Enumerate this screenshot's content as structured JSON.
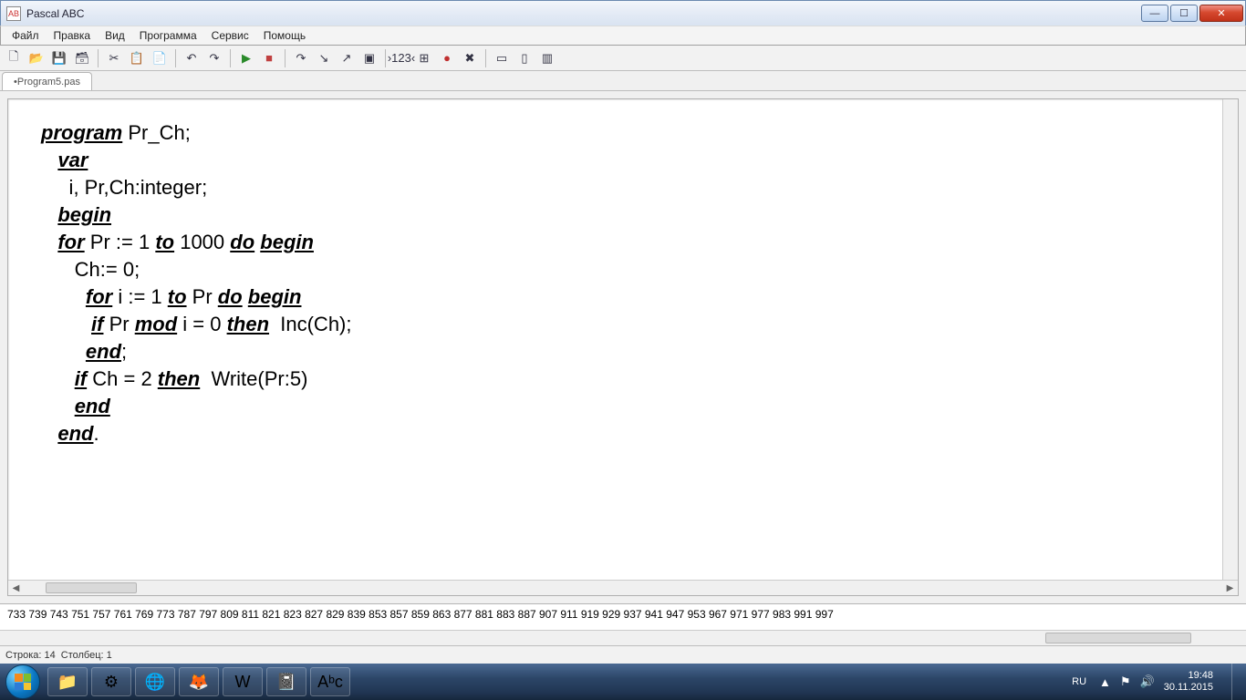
{
  "window": {
    "app_icon_text": "AB",
    "title": "Pascal ABC"
  },
  "menubar": [
    "Файл",
    "Правка",
    "Вид",
    "Программа",
    "Сервис",
    "Помощь"
  ],
  "toolbar_icons": [
    {
      "name": "new-file-icon",
      "glyph": "🗋"
    },
    {
      "name": "open-file-icon",
      "glyph": "📂"
    },
    {
      "name": "save-icon",
      "glyph": "💾"
    },
    {
      "name": "save-all-icon",
      "glyph": "🗃"
    },
    {
      "sep": true
    },
    {
      "name": "cut-icon",
      "glyph": "✂"
    },
    {
      "name": "copy-icon",
      "glyph": "📋"
    },
    {
      "name": "paste-icon",
      "glyph": "📄"
    },
    {
      "sep": true
    },
    {
      "name": "undo-icon",
      "glyph": "↶"
    },
    {
      "name": "redo-icon",
      "glyph": "↷"
    },
    {
      "sep": true
    },
    {
      "name": "run-icon",
      "glyph": "▶",
      "cls": "ico-play"
    },
    {
      "name": "stop-icon",
      "glyph": "■",
      "cls": "ico-stop"
    },
    {
      "sep": true
    },
    {
      "name": "step-over-icon",
      "glyph": "↷"
    },
    {
      "name": "step-into-icon",
      "glyph": "↘"
    },
    {
      "name": "step-out-icon",
      "glyph": "↗"
    },
    {
      "name": "run-to-cursor-icon",
      "glyph": "▣"
    },
    {
      "sep": true
    },
    {
      "name": "watch-icon",
      "glyph": "›123‹"
    },
    {
      "name": "locals-icon",
      "glyph": "⊞"
    },
    {
      "name": "breakpoint-icon",
      "glyph": "●",
      "cls": "ico-red"
    },
    {
      "name": "clear-icon",
      "glyph": "✖"
    },
    {
      "sep": true
    },
    {
      "name": "panel1-icon",
      "glyph": "▭"
    },
    {
      "name": "panel2-icon",
      "glyph": "▯"
    },
    {
      "name": "panel3-icon",
      "glyph": "▥"
    }
  ],
  "tab": {
    "label": "•Program5.pas"
  },
  "code_lines": [
    [
      {
        "t": "program",
        "kw": true
      },
      {
        "t": " Pr_Ch;"
      }
    ],
    [
      {
        "t": "   "
      },
      {
        "t": "var",
        "kw": true
      }
    ],
    [
      {
        "t": "     i, Pr,Ch:integer;"
      }
    ],
    [
      {
        "t": "   "
      },
      {
        "t": "begin",
        "kw": true
      }
    ],
    [
      {
        "t": "   "
      },
      {
        "t": "for",
        "kw": true
      },
      {
        "t": " Pr := 1 "
      },
      {
        "t": "to",
        "kw": true
      },
      {
        "t": " 1000 "
      },
      {
        "t": "do",
        "kw": true
      },
      {
        "t": " "
      },
      {
        "t": "begin",
        "kw": true
      }
    ],
    [
      {
        "t": "      Ch:= 0;"
      }
    ],
    [
      {
        "t": "        "
      },
      {
        "t": "for",
        "kw": true
      },
      {
        "t": " i := 1 "
      },
      {
        "t": "to",
        "kw": true
      },
      {
        "t": " Pr "
      },
      {
        "t": "do",
        "kw": true
      },
      {
        "t": " "
      },
      {
        "t": "begin",
        "kw": true
      }
    ],
    [
      {
        "t": "         "
      },
      {
        "t": "if",
        "kw": true
      },
      {
        "t": " Pr "
      },
      {
        "t": "mod",
        "kw": true
      },
      {
        "t": " i = 0 "
      },
      {
        "t": "then",
        "kw": true
      },
      {
        "t": "  Inc(Ch);"
      }
    ],
    [
      {
        "t": "        "
      },
      {
        "t": "end",
        "kw": true
      },
      {
        "t": ";"
      }
    ],
    [
      {
        "t": "      "
      },
      {
        "t": "if",
        "kw": true
      },
      {
        "t": " Ch = 2 "
      },
      {
        "t": "then",
        "kw": true
      },
      {
        "t": "  Write(Pr:5)"
      }
    ],
    [
      {
        "t": "      "
      },
      {
        "t": "end",
        "kw": true
      }
    ],
    [
      {
        "t": "   "
      },
      {
        "t": "end",
        "kw": true
      },
      {
        "t": "."
      }
    ]
  ],
  "output_numbers": "733  739  743  751  757  761  769  773  787  797  809  811  821  823  827  829  839  853  857  859  863  877  881  883  887  907  911  919  929  937  941  947  953  967  971  977  983  991  997",
  "status": {
    "line_label": "Строка: 14",
    "col_label": "Столбец: 1"
  },
  "tray": {
    "lang": "RU",
    "time": "19:48",
    "date": "30.11.2015"
  },
  "task_icons": [
    {
      "name": "explorer-icon",
      "glyph": "📁"
    },
    {
      "name": "code-icon",
      "glyph": "⚙"
    },
    {
      "name": "mozilla-icon",
      "glyph": "🌐"
    },
    {
      "name": "firefox-icon",
      "glyph": "🦊"
    },
    {
      "name": "word-icon",
      "glyph": "W"
    },
    {
      "name": "notes-icon",
      "glyph": "📓"
    },
    {
      "name": "pascal-abc-icon",
      "glyph": "Aᵇc"
    }
  ]
}
